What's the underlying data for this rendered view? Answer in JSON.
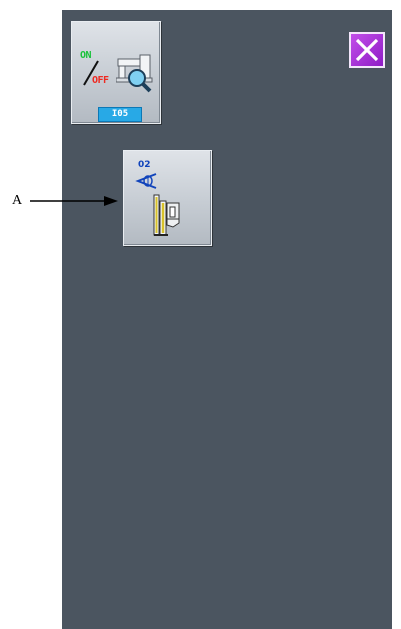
{
  "indicator_button": {
    "on_label": "ON",
    "off_label": "OFF",
    "code": "I05",
    "icon": "sewing-machine-magnifier-icon"
  },
  "close_button": {
    "icon": "close-icon",
    "color": "#a83ad6"
  },
  "submenu_button": {
    "number": "02",
    "icons": [
      "thread-sensor-marker-icon",
      "presser-foot-icon"
    ]
  },
  "callout": {
    "label": "A"
  },
  "colors": {
    "screen_bg": "#4b5560",
    "on_green": "#19c23a",
    "off_red": "#ee2a22",
    "code_bg": "#28a9e6"
  }
}
